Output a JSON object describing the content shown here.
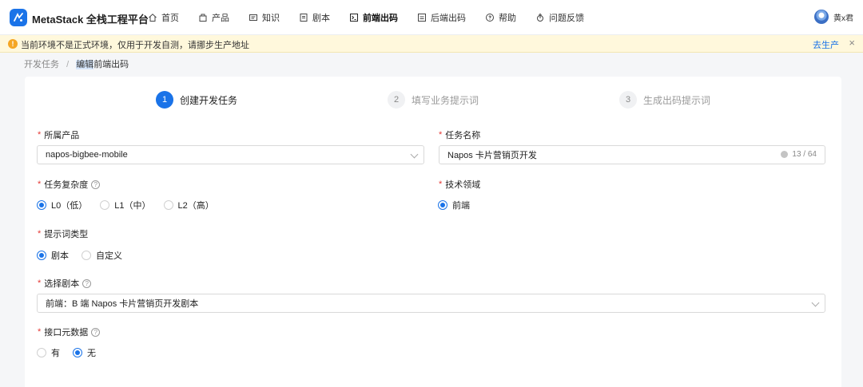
{
  "brand": {
    "title": "MetaStack 全栈工程平台"
  },
  "nav": [
    {
      "label": "首页",
      "icon": "home-icon"
    },
    {
      "label": "产品",
      "icon": "product-icon"
    },
    {
      "label": "知识",
      "icon": "book-icon"
    },
    {
      "label": "剧本",
      "icon": "script-icon"
    },
    {
      "label": "前端出码",
      "icon": "frontend-code-icon",
      "active": true
    },
    {
      "label": "后端出码",
      "icon": "backend-code-icon"
    },
    {
      "label": "帮助",
      "icon": "help-icon"
    },
    {
      "label": "问题反馈",
      "icon": "feedback-icon"
    }
  ],
  "user": {
    "name": "黄x君"
  },
  "alert": {
    "text": "当前环境不是正式环境，仅用于开发自测，请挪步生产地址",
    "link": "去生产",
    "close": "×"
  },
  "breadcrumb": {
    "parent": "开发任务",
    "separator": "/",
    "current_a": "编辑",
    "current_b": "前端出码"
  },
  "steps": [
    {
      "num": "1",
      "label": "创建开发任务",
      "active": true
    },
    {
      "num": "2",
      "label": "填写业务提示词"
    },
    {
      "num": "3",
      "label": "生成出码提示词"
    }
  ],
  "form": {
    "product": {
      "label": "所属产品",
      "value": "napos-bigbee-mobile"
    },
    "task_name": {
      "label": "任务名称",
      "value": "Napos 卡片营销页开发",
      "count": "13 / 64"
    },
    "complexity": {
      "label": "任务复杂度",
      "options": [
        "L0（低）",
        "L1（中）",
        "L2（高）"
      ],
      "selected": 0
    },
    "domain": {
      "label": "技术领域",
      "options": [
        "前端"
      ],
      "selected": 0
    },
    "prompt_type": {
      "label": "提示词类型",
      "options": [
        "剧本",
        "自定义"
      ],
      "selected": 0
    },
    "script": {
      "label": "选择剧本",
      "value": "前端：B 端 Napos 卡片营销页开发剧本"
    },
    "api_meta": {
      "label": "接口元数据",
      "options": [
        "有",
        "无"
      ],
      "selected": 1
    }
  },
  "colors": {
    "accent": "#1a73e8",
    "required": "#e53935",
    "banner": "#fff8dc",
    "banner_icon": "#f5a623"
  }
}
